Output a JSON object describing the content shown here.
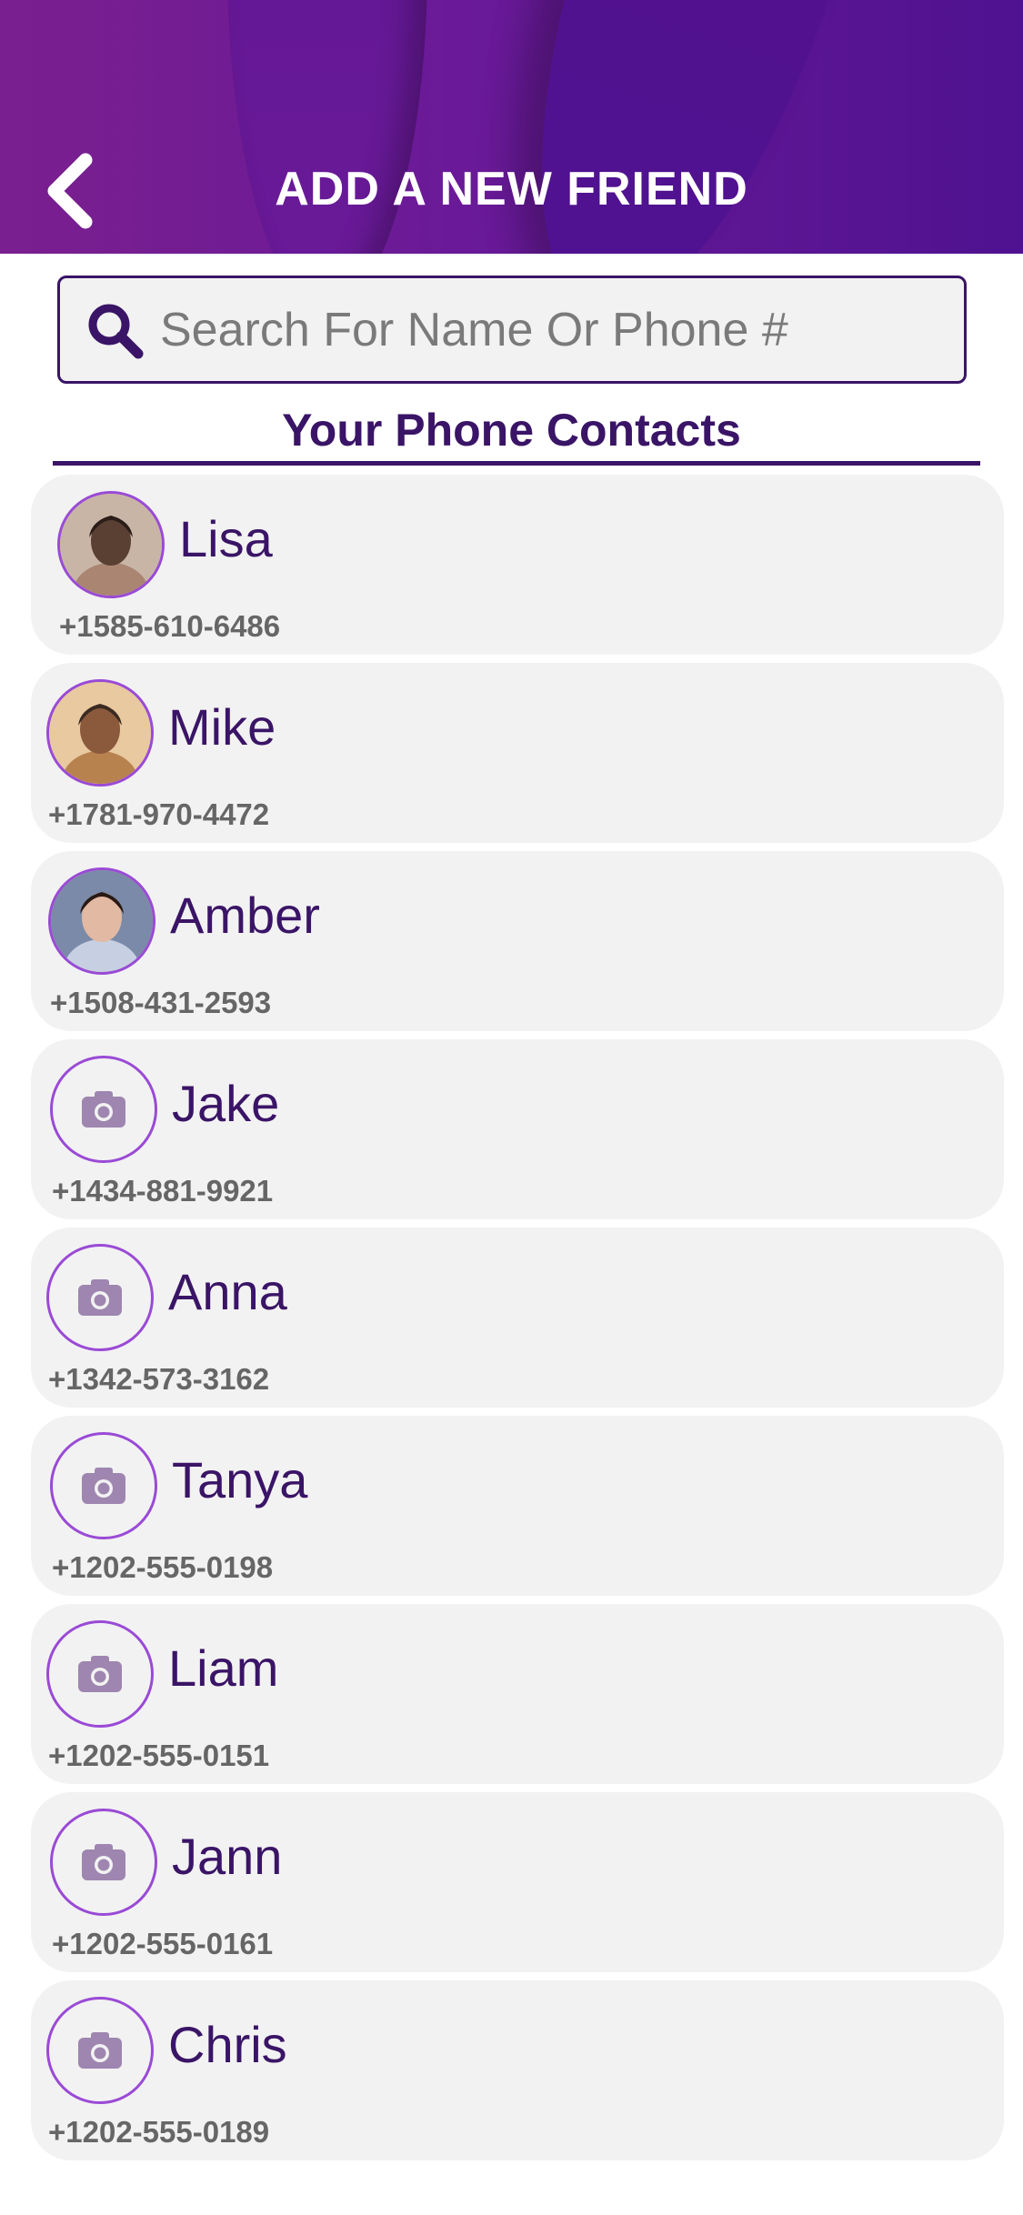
{
  "header": {
    "title": "ADD A NEW FRIEND",
    "back_icon": "chevron-left-icon",
    "gradient_colors": [
      "#7a1f8f",
      "#4f1290"
    ]
  },
  "search": {
    "placeholder": "Search For Name Or Phone #",
    "value": "",
    "icon": "search-icon"
  },
  "contacts_section": {
    "title": "Your Phone Contacts"
  },
  "contacts": [
    {
      "name": "Lisa",
      "phone": "+1585-610-6486",
      "avatar": "photo"
    },
    {
      "name": "Mike",
      "phone": "+1781-970-4472",
      "avatar": "photo"
    },
    {
      "name": "Amber",
      "phone": "+1508-431-2593",
      "avatar": "photo"
    },
    {
      "name": "Jake",
      "phone": "+1434-881-9921",
      "avatar": "camera-icon"
    },
    {
      "name": "Anna",
      "phone": "+1342-573-3162",
      "avatar": "camera-icon"
    },
    {
      "name": "Tanya",
      "phone": "+1202-555-0198",
      "avatar": "camera-icon"
    },
    {
      "name": "Liam",
      "phone": "+1202-555-0151",
      "avatar": "camera-icon"
    },
    {
      "name": "Jann",
      "phone": "+1202-555-0161",
      "avatar": "camera-icon"
    },
    {
      "name": "Chris",
      "phone": "+1202-555-0189",
      "avatar": "camera-icon"
    }
  ],
  "colors": {
    "accent": "#3a1466",
    "avatar_ring": "#9a4ad6",
    "card_bg": "#f2f2f2",
    "camera_icon": "#9e86b0"
  }
}
